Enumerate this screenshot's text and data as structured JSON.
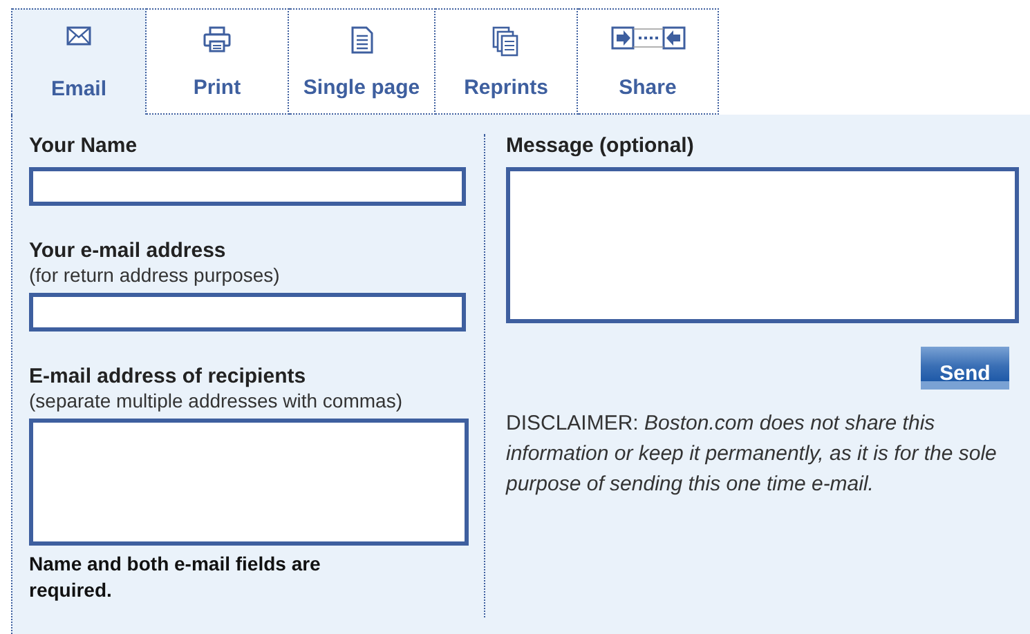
{
  "tabs": [
    {
      "label": "Email",
      "selected": true
    },
    {
      "label": "Print",
      "selected": false
    },
    {
      "label": "Single page",
      "selected": false
    },
    {
      "label": "Reprints",
      "selected": false
    },
    {
      "label": "Share",
      "selected": false
    }
  ],
  "left": {
    "fields": [
      {
        "label": "Your Name",
        "kind": "input"
      },
      {
        "label": "Your e-mail address",
        "hint": "(for return address purposes)",
        "kind": "input"
      },
      {
        "label": "E-mail address of recipients",
        "hint": "(separate multiple addresses with commas)",
        "kind": "textarea"
      }
    ],
    "note": "Name and both e-mail fields are required."
  },
  "right": {
    "message_label": "Message (optional)",
    "send_button": "Send",
    "disclaimer": "DISCLAIMER: *Boston.com does not share this information or keep it permanently, as it is for the sole purpose of sending this one time e-mail.*"
  }
}
